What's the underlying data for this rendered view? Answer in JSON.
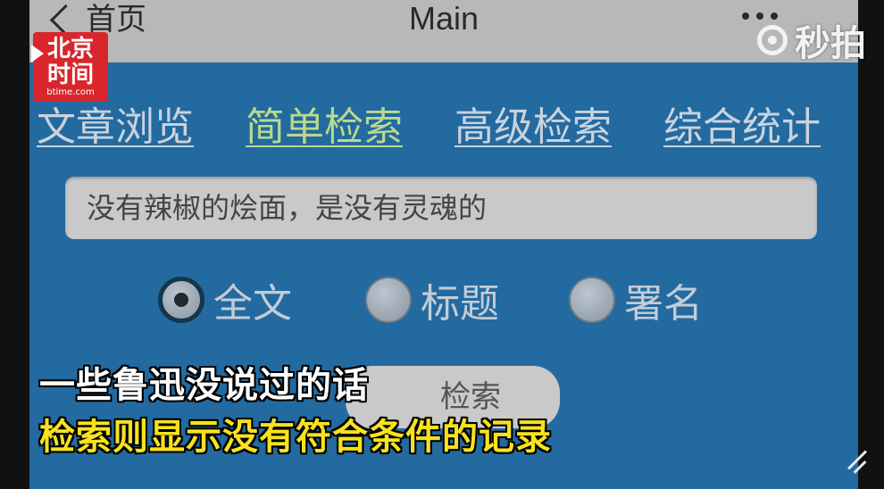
{
  "topbar": {
    "back_label": "首页",
    "title": "Main"
  },
  "tabs": [
    {
      "label": "文章浏览",
      "active": false
    },
    {
      "label": "简单检索",
      "active": true
    },
    {
      "label": "高级检索",
      "active": false
    },
    {
      "label": "综合统计",
      "active": false
    }
  ],
  "search": {
    "value": "没有辣椒的烩面，是没有灵魂的"
  },
  "radios": [
    {
      "label": "全文",
      "checked": true
    },
    {
      "label": "标题",
      "checked": false
    },
    {
      "label": "署名",
      "checked": false
    }
  ],
  "search_button_label": "检索",
  "logo": {
    "top": "北京",
    "middle": "时间",
    "bottom": "btime.com"
  },
  "watermark": "秒拍",
  "subtitles": {
    "line1": "一些鲁迅没说过的话",
    "line2": "检索则显示没有符合条件的记录"
  },
  "colors": {
    "background": "#236aa0",
    "active_tab": "#b9d98c",
    "subtitle_highlight": "#f7e21e",
    "logo_red": "#d8262c"
  }
}
